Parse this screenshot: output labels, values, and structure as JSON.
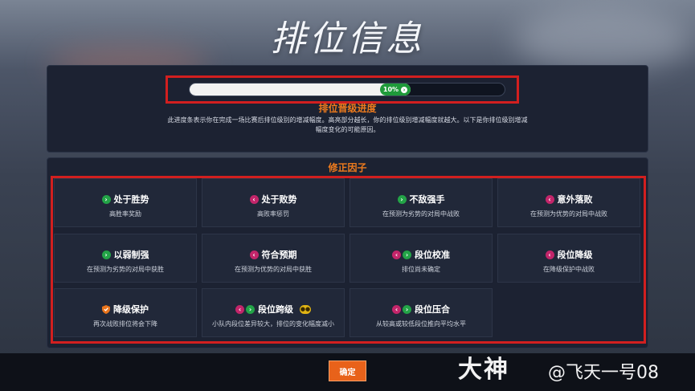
{
  "page_title": "排位信息",
  "progress": {
    "fraction": 0.1,
    "label": "10%",
    "title": "排位晋级进度",
    "description": "此进度条表示你在完成一场比赛后排位级别的增减幅度。高亮部分越长，你的排位级别增减幅度就越大。以下是你排位级别增减幅度变化的可能原因。"
  },
  "factors": {
    "title": "修正因子",
    "items": [
      {
        "label": "处于胜势",
        "sub": "高胜率奖励",
        "icons": [
          "up-arrow-icon"
        ]
      },
      {
        "label": "处于败势",
        "sub": "高败率惩罚",
        "icons": [
          "down-arrow-icon"
        ]
      },
      {
        "label": "不敌强手",
        "sub": "在预测为劣势的对局中战败",
        "icons": [
          "up-arrow-icon"
        ]
      },
      {
        "label": "意外落败",
        "sub": "在预测为优势的对局中战败",
        "icons": [
          "down-arrow-icon"
        ]
      },
      {
        "label": "以弱制强",
        "sub": "在预测为劣势的对局中获胜",
        "icons": [
          "up-arrow-icon"
        ]
      },
      {
        "label": "符合预期",
        "sub": "在预测为优势的对局中获胜",
        "icons": [
          "down-arrow-icon"
        ]
      },
      {
        "label": "段位校准",
        "sub": "排位尚未确定",
        "icons": [
          "down-arrow-icon",
          "up-arrow-icon"
        ]
      },
      {
        "label": "段位降级",
        "sub": "在降级保护中战败",
        "icons": [
          "down-arrow-icon"
        ]
      },
      {
        "label": "降级保护",
        "sub": "再次战败排位将会下降",
        "icons": [
          "shield-icon"
        ]
      },
      {
        "label": "段位跨级",
        "sub": "小队内段位差异较大，排位的变化幅度减小",
        "icons": [
          "down-arrow-icon",
          "up-arrow-icon"
        ],
        "badge": "group-badge-icon"
      },
      {
        "label": "段位压合",
        "sub": "从较高或较低段位推向平均水平",
        "icons": [
          "down-arrow-icon",
          "up-arrow-icon"
        ]
      }
    ]
  },
  "confirm_button": "确定",
  "watermark": {
    "logo": "大神",
    "user": "@飞天一号08"
  },
  "colors": {
    "accent": "#ee7b1d",
    "up": "#23a447",
    "down": "#c3256a",
    "highlight_box": "#d21f1f"
  }
}
